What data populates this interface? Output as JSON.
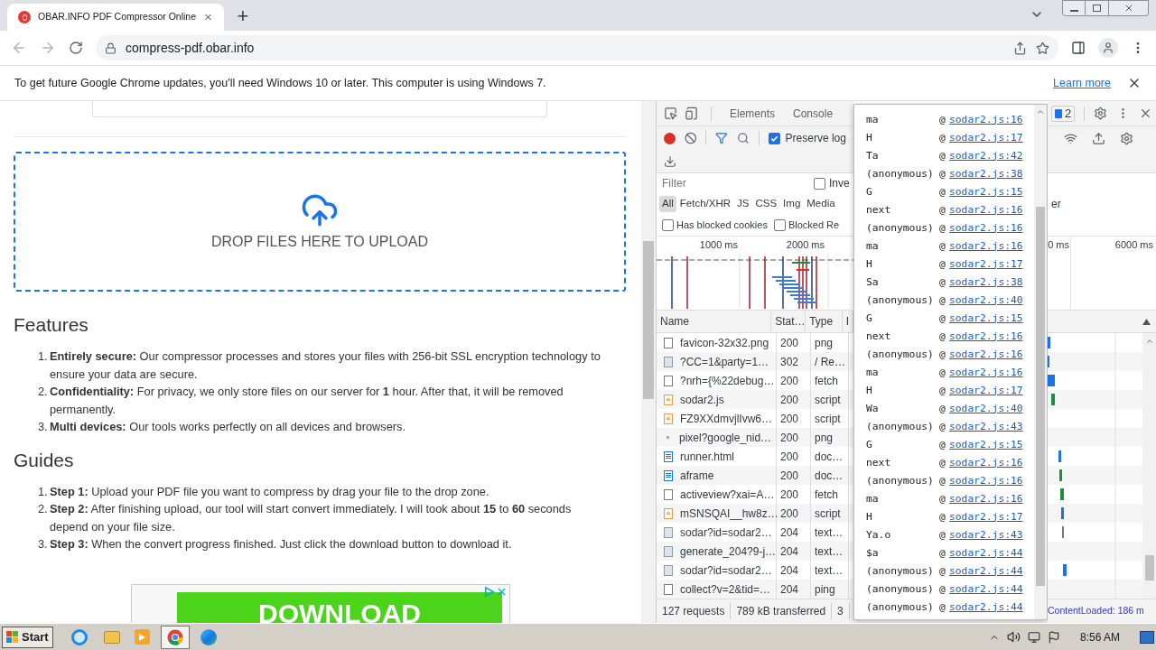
{
  "browser": {
    "tab": {
      "title": "OBAR.INFO PDF Compressor Online",
      "selected": true
    },
    "new_tab": "+",
    "url": "compress-pdf.obar.info"
  },
  "infobar": {
    "message": "To get future Google Chrome updates, you'll need Windows 10 or later. This computer is using Windows 7.",
    "link": "Learn more"
  },
  "page": {
    "dropzone": "DROP FILES HERE TO UPLOAD",
    "features": {
      "heading": "Features",
      "items": [
        {
          "number": "1.",
          "text": "**Entirely secure:** Our compressor processes and stores your files with 256-bit SSL encryption technology to ensure your data are secure."
        },
        {
          "number": "2.",
          "text": "**Confidentiality:** For privacy, we only store files on our server for **1** hour. After that, it will be removed permanently."
        },
        {
          "number": "3.",
          "text": "**Multi devices:** Our tools works perfectly on all devices and browsers."
        }
      ]
    },
    "guides": {
      "heading": "Guides",
      "items": [
        {
          "number": "1.",
          "text": "**Step 1:** Upload your PDF file you want to compress by drag your file to the drop zone."
        },
        {
          "number": "2.",
          "text": "**Step 2:** After finishing upload, our tool will start convert immediately. I will took about **15** to **60** seconds depend on your file size."
        },
        {
          "number": "3.",
          "text": "**Step 3:** When the convert progress finished. Just click the download button to download it."
        }
      ]
    },
    "ad": {
      "button": "DOWNLOAD"
    }
  },
  "devtools": {
    "tabs": [
      {
        "label": "Elements",
        "selected": false
      },
      {
        "label": "Console",
        "selected": false
      }
    ],
    "issues_badge": "2",
    "preserve_log": {
      "label": "Preserve log",
      "checked": true
    },
    "filter": {
      "placeholder": "Filter"
    },
    "invert": {
      "label": "Inve",
      "checked": false
    },
    "types": [
      {
        "label": "All",
        "selected": true
      },
      {
        "label": "Fetch/XHR",
        "selected": false
      },
      {
        "label": "JS",
        "selected": false
      },
      {
        "label": "CSS",
        "selected": false
      },
      {
        "label": "Img",
        "selected": false
      },
      {
        "label": "Media",
        "selected": false
      }
    ],
    "types_overflow": "er",
    "blocked": [
      {
        "label": "Has blocked cookies",
        "checked": false
      },
      {
        "label": "Blocked Re",
        "checked": false
      }
    ],
    "overview_ticks": [
      "1000 ms",
      "2000 ms",
      "0 ms",
      "6000 ms"
    ],
    "columns": [
      "Name",
      "Stat…",
      "Type",
      "I"
    ],
    "rows": [
      {
        "name": "favicon-32x32.png",
        "status": "200",
        "type": "png",
        "kind": "blank"
      },
      {
        "name": "?CC=1&party=1…",
        "status": "302",
        "type": "/ Re…",
        "kind": "image"
      },
      {
        "name": "?nrh={%22debug…",
        "status": "200",
        "type": "fetch",
        "kind": "blank"
      },
      {
        "name": "sodar2.js",
        "status": "200",
        "type": "script",
        "kind": "script"
      },
      {
        "name": "FZ9XXdmvjlIvw6…",
        "status": "200",
        "type": "script",
        "kind": "script"
      },
      {
        "name": "pixel?google_nid…",
        "status": "200",
        "type": "png",
        "kind": "dot"
      },
      {
        "name": "runner.html",
        "status": "200",
        "type": "doc…",
        "kind": "doc"
      },
      {
        "name": "aframe",
        "status": "200",
        "type": "doc…",
        "kind": "doc"
      },
      {
        "name": "activeview?xai=A…",
        "status": "200",
        "type": "fetch",
        "kind": "blank"
      },
      {
        "name": "mSNSQAI__hw8z…",
        "status": "200",
        "type": "script",
        "kind": "script"
      },
      {
        "name": "sodar?id=sodar2…",
        "status": "204",
        "type": "text…",
        "kind": "image"
      },
      {
        "name": "generate_204?9-j…",
        "status": "204",
        "type": "text…",
        "kind": "image"
      },
      {
        "name": "sodar?id=sodar2…",
        "status": "204",
        "type": "text…",
        "kind": "image"
      },
      {
        "name": "collect?v=2&tid=…",
        "status": "204",
        "type": "ping",
        "kind": "blank"
      }
    ],
    "footer": [
      "127 requests",
      "789 kB transferred",
      "3"
    ],
    "dom_loaded": "ContentLoaded: 186 m"
  },
  "stack_popup": {
    "frames": [
      {
        "function": "ma",
        "at": "@",
        "location": "sodar2.js:16"
      },
      {
        "function": "H",
        "at": "@",
        "location": "sodar2.js:17"
      },
      {
        "function": "Ta",
        "at": "@",
        "location": "sodar2.js:42"
      },
      {
        "function": "(anonymous)",
        "at": "@",
        "location": "sodar2.js:38"
      },
      {
        "function": "G",
        "at": "@",
        "location": "sodar2.js:15"
      },
      {
        "function": "next",
        "at": "@",
        "location": "sodar2.js:16"
      },
      {
        "function": "(anonymous)",
        "at": "@",
        "location": "sodar2.js:16"
      },
      {
        "function": "ma",
        "at": "@",
        "location": "sodar2.js:16"
      },
      {
        "function": "H",
        "at": "@",
        "location": "sodar2.js:17"
      },
      {
        "function": "Sa",
        "at": "@",
        "location": "sodar2.js:38"
      },
      {
        "function": "(anonymous)",
        "at": "@",
        "location": "sodar2.js:40"
      },
      {
        "function": "G",
        "at": "@",
        "location": "sodar2.js:15"
      },
      {
        "function": "next",
        "at": "@",
        "location": "sodar2.js:16"
      },
      {
        "function": "(anonymous)",
        "at": "@",
        "location": "sodar2.js:16"
      },
      {
        "function": "ma",
        "at": "@",
        "location": "sodar2.js:16"
      },
      {
        "function": "H",
        "at": "@",
        "location": "sodar2.js:17"
      },
      {
        "function": "Wa",
        "at": "@",
        "location": "sodar2.js:40"
      },
      {
        "function": "(anonymous)",
        "at": "@",
        "location": "sodar2.js:43"
      },
      {
        "function": "G",
        "at": "@",
        "location": "sodar2.js:15"
      },
      {
        "function": "next",
        "at": "@",
        "location": "sodar2.js:16"
      },
      {
        "function": "(anonymous)",
        "at": "@",
        "location": "sodar2.js:16"
      },
      {
        "function": "ma",
        "at": "@",
        "location": "sodar2.js:16"
      },
      {
        "function": "H",
        "at": "@",
        "location": "sodar2.js:17"
      },
      {
        "function": "Ya.o",
        "at": "@",
        "location": "sodar2.js:43"
      },
      {
        "function": "$a",
        "at": "@",
        "location": "sodar2.js:44"
      },
      {
        "function": "(anonymous)",
        "at": "@",
        "location": "sodar2.js:44"
      },
      {
        "function": "(anonymous)",
        "at": "@",
        "location": "sodar2.js:44"
      },
      {
        "function": "(anonymous)",
        "at": "@",
        "location": "sodar2.js:44"
      }
    ]
  },
  "taskbar": {
    "start": "Start",
    "clock": "8:56 AM"
  }
}
